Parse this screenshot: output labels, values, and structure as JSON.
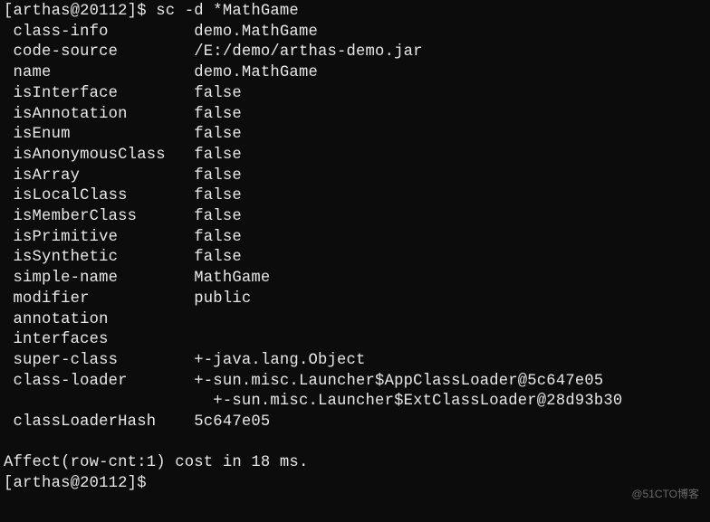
{
  "prompt1": {
    "full": "[arthas@20112]$ sc -d *MathGame"
  },
  "rows": [
    {
      "k": " class-info",
      "v": "demo.MathGame"
    },
    {
      "k": " code-source",
      "v": "/E:/demo/arthas-demo.jar"
    },
    {
      "k": " name",
      "v": "demo.MathGame"
    },
    {
      "k": " isInterface",
      "v": "false"
    },
    {
      "k": " isAnnotation",
      "v": "false"
    },
    {
      "k": " isEnum",
      "v": "false"
    },
    {
      "k": " isAnonymousClass",
      "v": "false"
    },
    {
      "k": " isArray",
      "v": "false"
    },
    {
      "k": " isLocalClass",
      "v": "false"
    },
    {
      "k": " isMemberClass",
      "v": "false"
    },
    {
      "k": " isPrimitive",
      "v": "false"
    },
    {
      "k": " isSynthetic",
      "v": "false"
    },
    {
      "k": " simple-name",
      "v": "MathGame"
    },
    {
      "k": " modifier",
      "v": "public"
    },
    {
      "k": " annotation",
      "v": ""
    },
    {
      "k": " interfaces",
      "v": ""
    },
    {
      "k": " super-class",
      "v": "+-java.lang.Object"
    },
    {
      "k": " class-loader",
      "v": "+-sun.misc.Launcher$AppClassLoader@5c647e05"
    },
    {
      "k": "",
      "v": "  +-sun.misc.Launcher$ExtClassLoader@28d93b30"
    },
    {
      "k": " classLoaderHash",
      "v": "5c647e05"
    }
  ],
  "affect": "Affect(row-cnt:1) cost in 18 ms.",
  "prompt2": "[arthas@20112]$",
  "watermark": "@51CTO博客",
  "keycol_width": 20
}
